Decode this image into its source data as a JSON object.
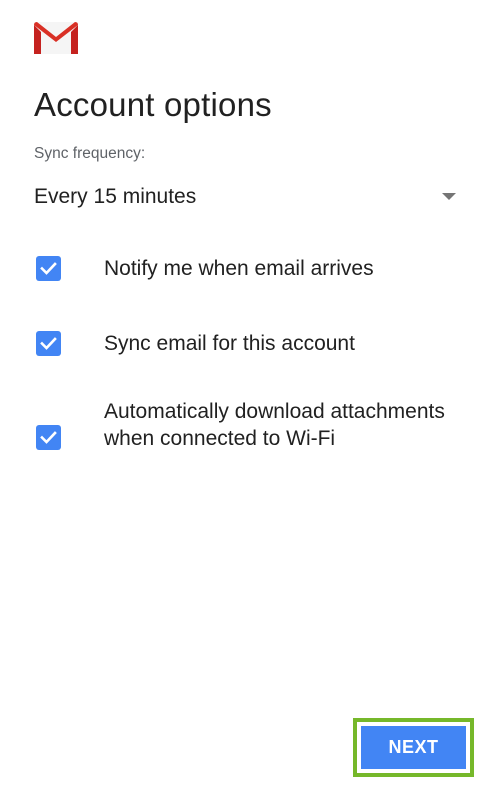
{
  "header": {
    "logo_icon": "gmail-logo-icon",
    "title": "Account options"
  },
  "sync": {
    "label": "Sync frequency:",
    "value": "Every 15 minutes",
    "arrow_icon": "dropdown-arrow-icon"
  },
  "options": [
    {
      "label": "Notify me when email arrives",
      "checked": true
    },
    {
      "label": "Sync email for this account",
      "checked": true
    },
    {
      "label": "Automatically download attachments when connected to Wi-Fi",
      "checked": true
    }
  ],
  "footer": {
    "next_label": "NEXT"
  },
  "colors": {
    "accent": "#4285f4",
    "highlight": "#76b82a",
    "gmail_red": "#d93025"
  }
}
